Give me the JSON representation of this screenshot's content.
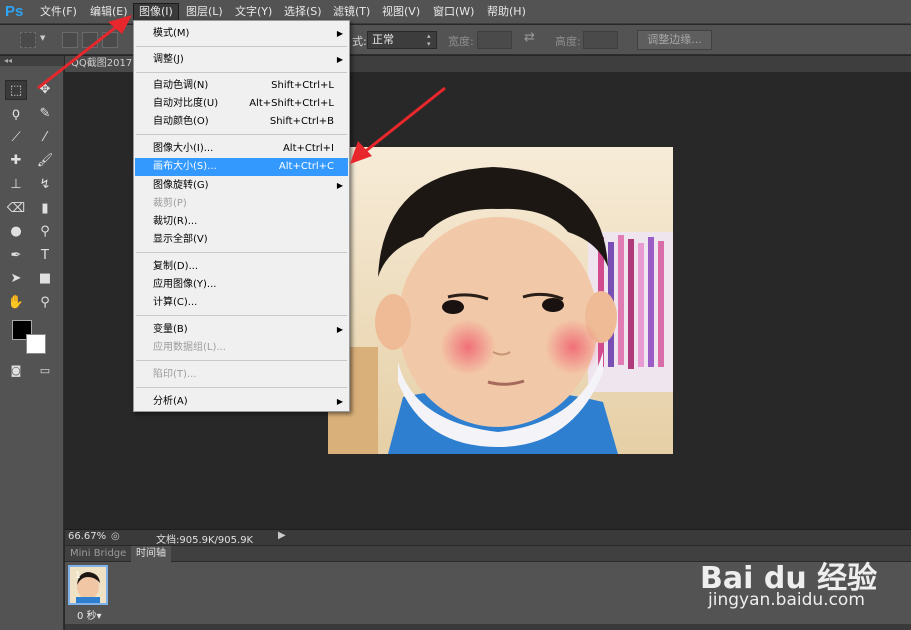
{
  "app": {
    "logo": "Ps"
  },
  "menubar": {
    "items": [
      "文件(F)",
      "编辑(E)",
      "图像(I)",
      "图层(L)",
      "文字(Y)",
      "选择(S)",
      "滤镜(T)",
      "视图(V)",
      "窗口(W)",
      "帮助(H)"
    ],
    "active": "图像(I)"
  },
  "options": {
    "style_label": "正常",
    "width_label": "宽度:",
    "height_label": "高度:",
    "refine_label": "调整边缘..."
  },
  "document": {
    "tab_title": "QQ截图2017"
  },
  "image_menu": {
    "items": [
      {
        "label": "模式(M)",
        "submenu": true
      },
      {
        "label": "调整(J)",
        "submenu": true
      },
      {
        "label": "自动色调(N)",
        "shortcut": "Shift+Ctrl+L"
      },
      {
        "label": "自动对比度(U)",
        "shortcut": "Alt+Shift+Ctrl+L"
      },
      {
        "label": "自动颜色(O)",
        "shortcut": "Shift+Ctrl+B"
      },
      {
        "label": "图像大小(I)...",
        "shortcut": "Alt+Ctrl+I"
      },
      {
        "label": "画布大小(S)...",
        "shortcut": "Alt+Ctrl+C",
        "highlighted": true
      },
      {
        "label": "图像旋转(G)",
        "submenu": true
      },
      {
        "label": "裁剪(P)",
        "disabled": true
      },
      {
        "label": "裁切(R)..."
      },
      {
        "label": "显示全部(V)"
      },
      {
        "label": "复制(D)..."
      },
      {
        "label": "应用图像(Y)..."
      },
      {
        "label": "计算(C)..."
      },
      {
        "label": "变量(B)",
        "submenu": true
      },
      {
        "label": "应用数据组(L)...",
        "disabled": true
      },
      {
        "label": "陷印(T)...",
        "disabled": true
      },
      {
        "label": "分析(A)",
        "submenu": true
      }
    ]
  },
  "status": {
    "zoom": "66.67%",
    "doc_info": "文档:905.9K/905.9K"
  },
  "panels": {
    "tabs": [
      "Mini Bridge",
      "时间轴"
    ],
    "active": "时间轴"
  },
  "timeline": {
    "frame_number": "1",
    "frame_time": "0 秒▾"
  },
  "watermark": {
    "logo": "Bai du 经验",
    "url": "jingyan.baidu.com"
  },
  "colors": {
    "accent": "#3399ff",
    "arrow": "#e8272c",
    "panel": "#535353",
    "workspace": "#282828"
  }
}
